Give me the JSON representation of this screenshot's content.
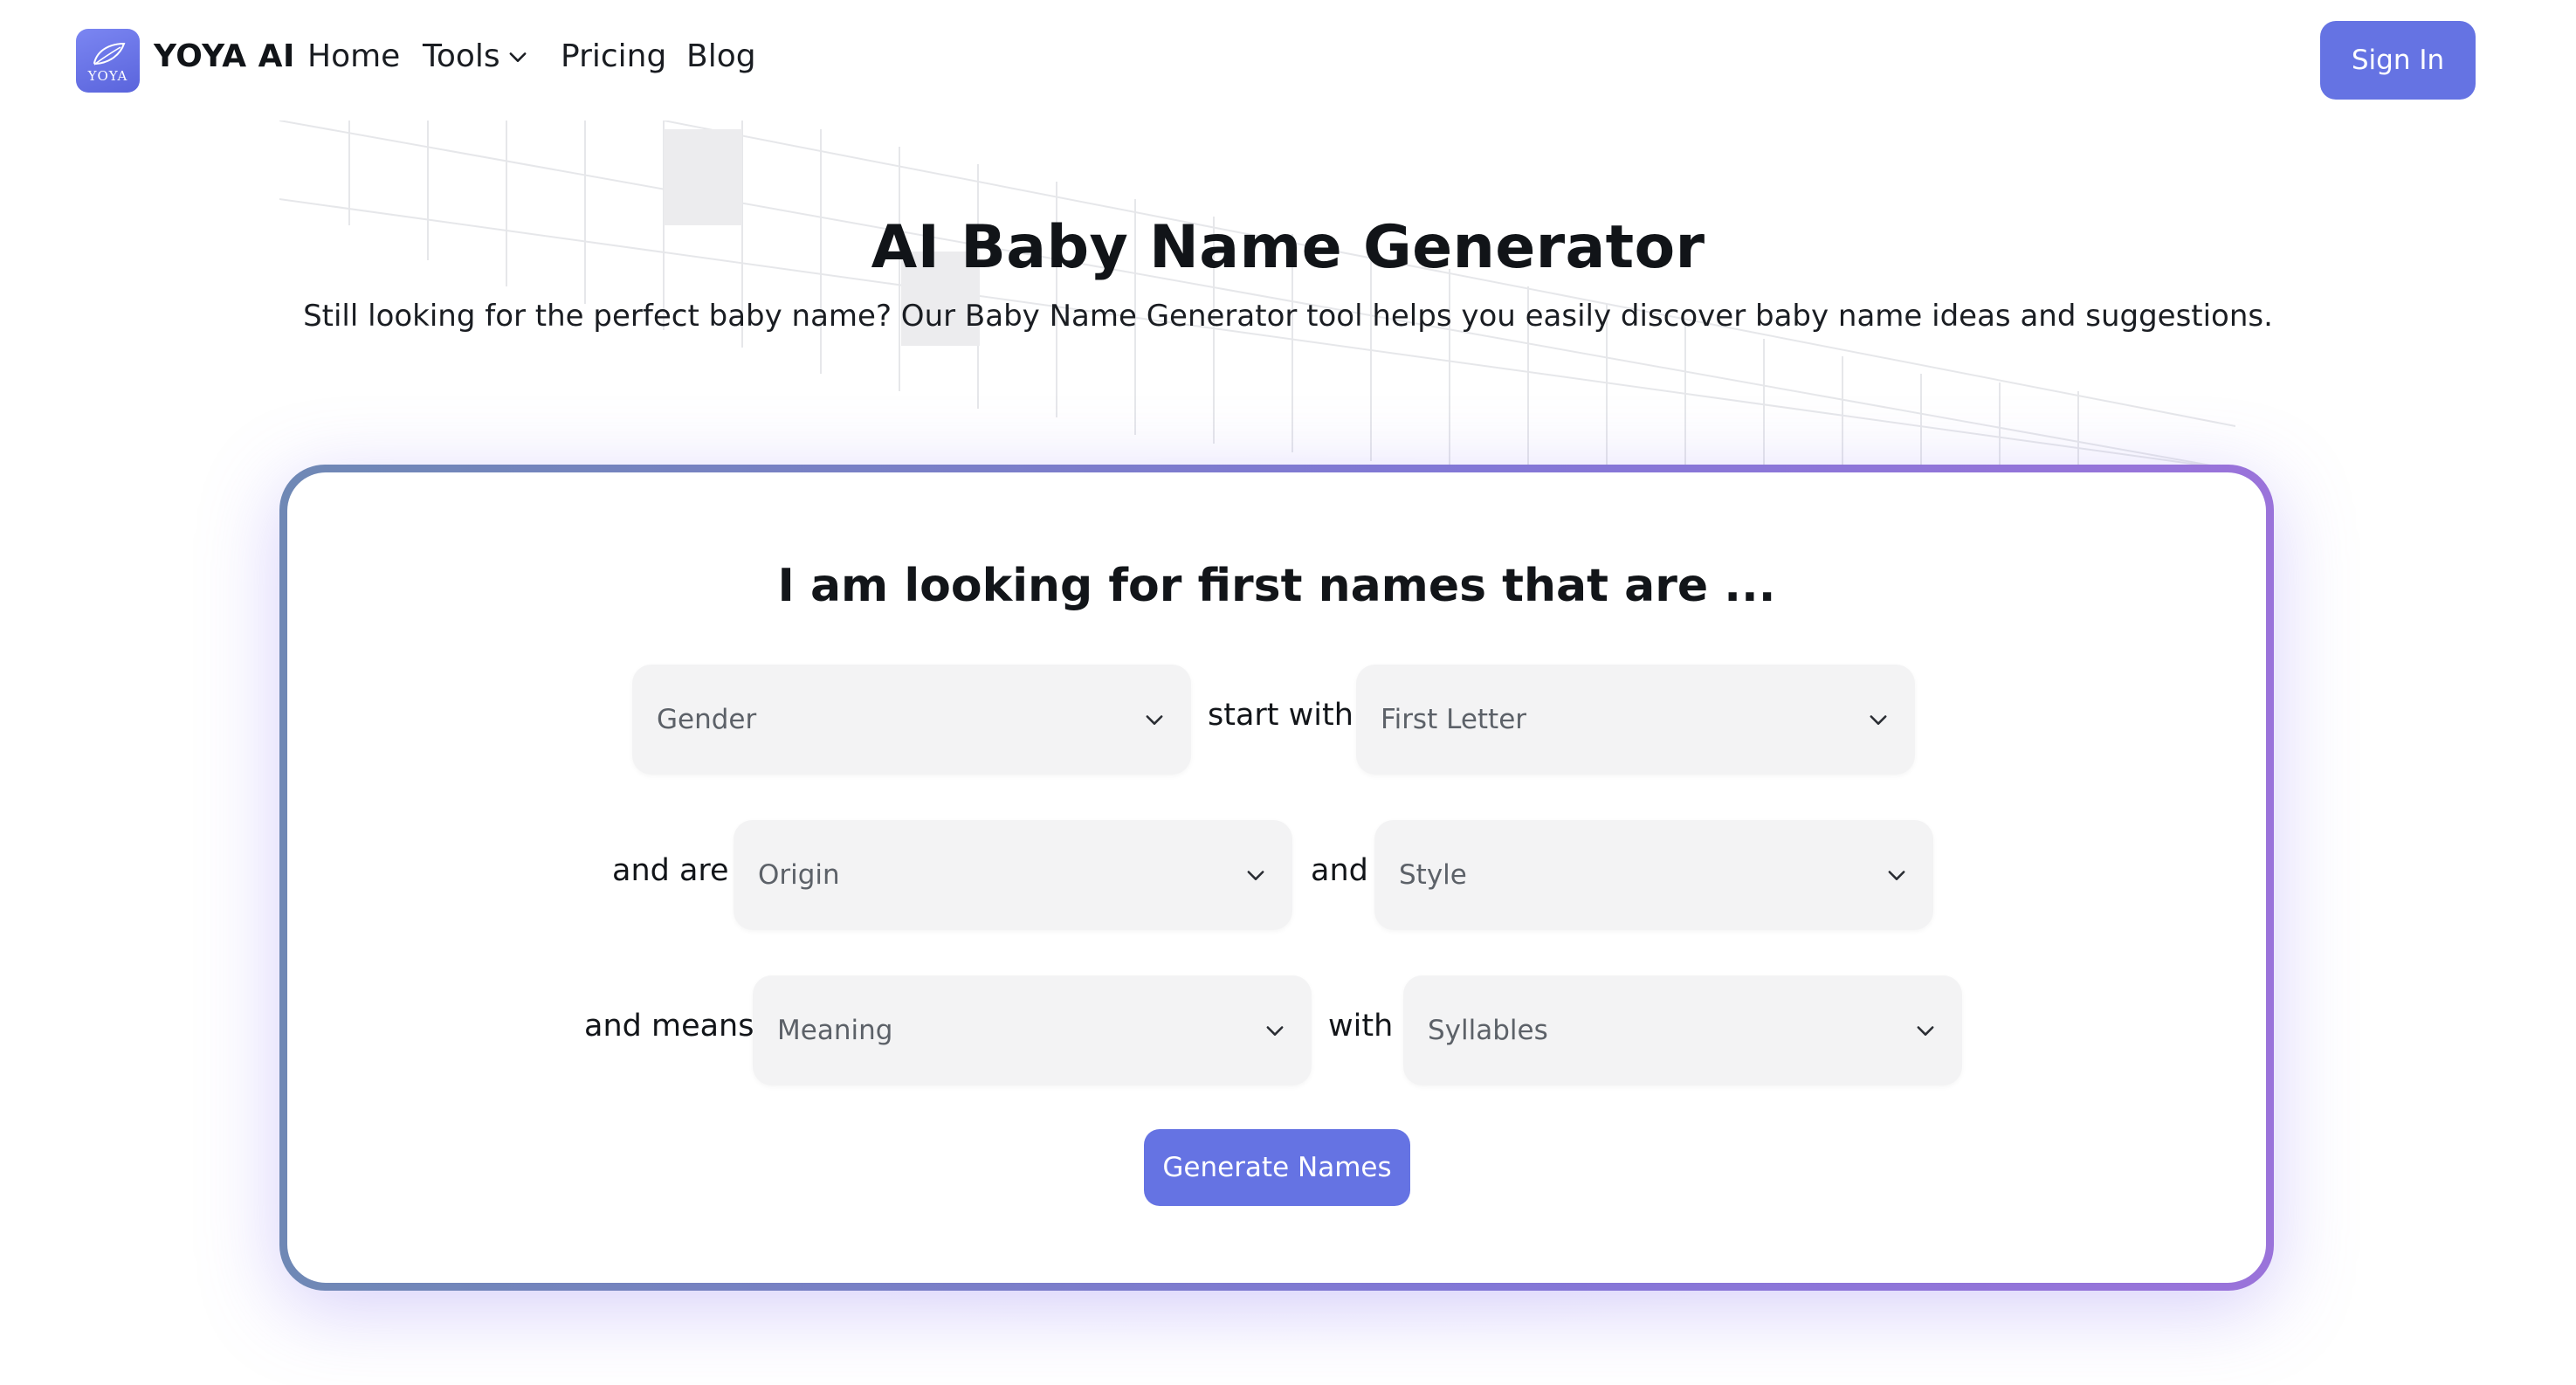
{
  "nav": {
    "logo_text": "YOYA",
    "brand": "YOYA AI",
    "links": {
      "home": "Home",
      "tools": "Tools",
      "pricing": "Pricing",
      "blog": "Blog"
    },
    "sign_in": "Sign In"
  },
  "hero": {
    "title": "AI Baby Name Generator",
    "subtitle": "Still looking for the perfect baby name? Our Baby Name Generator tool helps you easily discover baby name ideas and suggestions."
  },
  "form": {
    "heading": "I am looking for first names that are ...",
    "labels": {
      "start_with": "start with",
      "and_are": "and are",
      "and": "and",
      "and_means": "and means",
      "with": "with"
    },
    "selects": {
      "gender": "Gender",
      "first_letter": "First Letter",
      "origin": "Origin",
      "style": "Style",
      "meaning": "Meaning",
      "syllables": "Syllables"
    },
    "generate_button": "Generate Names"
  },
  "colors": {
    "accent": "#6573e3",
    "select_bg": "#f3f3f4",
    "card_border_start": "#6f88b5",
    "card_border_end": "#9a73da"
  },
  "icons": {
    "dropdown": "chevron-down-icon",
    "logo": "leaf-logo-icon"
  }
}
